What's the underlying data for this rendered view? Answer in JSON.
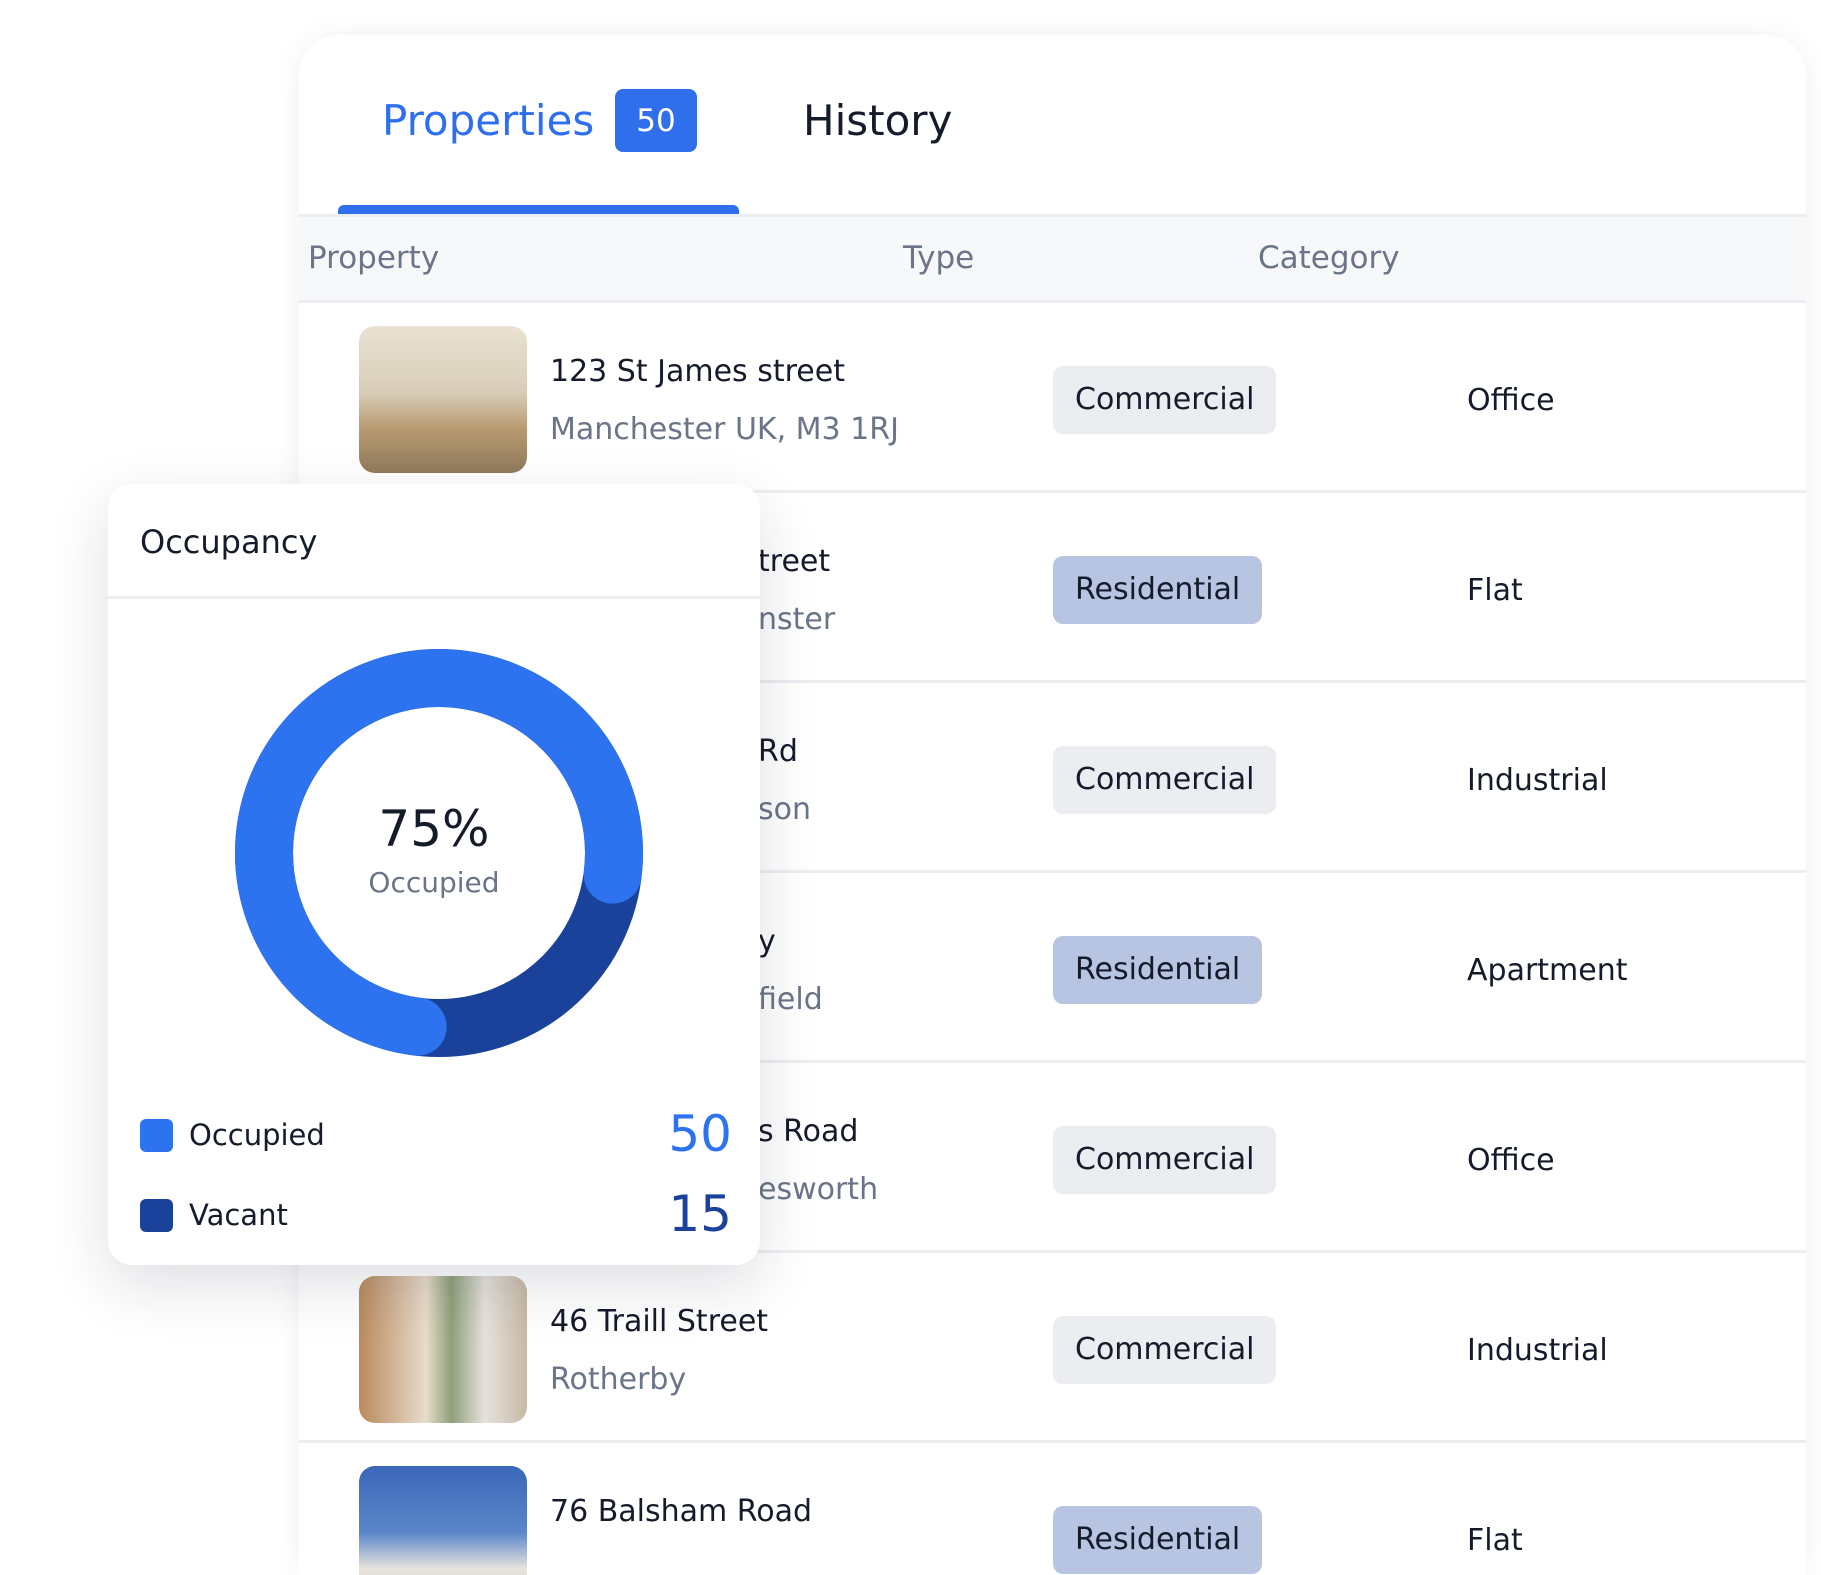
{
  "tabs": [
    {
      "label": "Properties",
      "badge": "50",
      "active": true
    },
    {
      "label": "History"
    }
  ],
  "columns": [
    "Property",
    "Type",
    "Category"
  ],
  "rows": [
    {
      "title": "123 St James street",
      "subtitle": "Manchester UK, M3 1RJ",
      "type": "Commercial",
      "category": "Office",
      "photo": "kitchen-corridor"
    },
    {
      "title": "treet",
      "subtitle": "nster",
      "type": "Residential",
      "category": "Flat",
      "partial": true
    },
    {
      "title": "Rd",
      "subtitle": "son",
      "type": "Commercial",
      "category": "Industrial",
      "partial": true
    },
    {
      "title": "y",
      "subtitle": "field",
      "type": "Residential",
      "category": "Apartment",
      "partial": true
    },
    {
      "title": "s Road",
      "subtitle": "esworth",
      "type": "Commercial",
      "category": "Office",
      "partial": true
    },
    {
      "title": "46 Traill Street",
      "subtitle": "Rotherby",
      "type": "Commercial",
      "category": "Industrial",
      "photo": "modern-kitchen"
    },
    {
      "title": "76 Balsham Road",
      "subtitle": "",
      "type": "Residential",
      "category": "Flat",
      "photo": "white-villa"
    }
  ],
  "occupancy": {
    "title": "Occupancy",
    "percent_label": "75%",
    "center_label": "Occupied",
    "legend": [
      {
        "label": "Occupied",
        "value": "50",
        "color": "#2d72ef"
      },
      {
        "label": "Vacant",
        "value": "15",
        "color": "#1b429a"
      }
    ]
  },
  "chart_data": {
    "type": "pie",
    "variant": "donut",
    "categories": [
      "Occupied",
      "Vacant"
    ],
    "values": [
      75,
      25
    ],
    "colors": [
      "#2d72ef",
      "#1b429a"
    ]
  },
  "colors": {
    "accent": "#2f6fec",
    "commercial_pill": "#ebedf1",
    "residential_pill": "#b7c5e3"
  }
}
